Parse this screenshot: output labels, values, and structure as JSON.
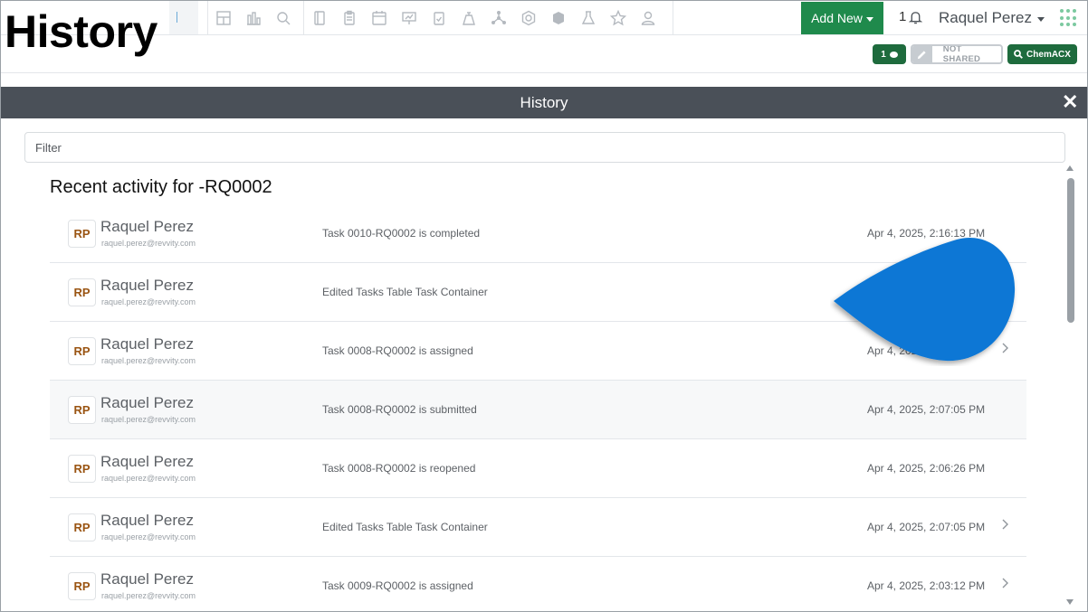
{
  "page_heading": "History",
  "topbar": {
    "add_new_label": "Add New",
    "notification_count": "1",
    "user_name": "Raquel Perez"
  },
  "subbar": {
    "comments_count": "1",
    "share_status": "NOT SHARED",
    "chemacx_label": "ChemACX"
  },
  "panel": {
    "title": "History",
    "close_label": "✕",
    "filter_placeholder": "Filter",
    "activity_title": "Recent activity for -RQ0002"
  },
  "activities": [
    {
      "initials": "RP",
      "user": "Raquel Perez",
      "email": "raquel.perez@revvity.com",
      "action": "Task 0010-RQ0002 is completed",
      "timestamp": "Apr 4, 2025, 2:16:13 PM",
      "has_details": false
    },
    {
      "initials": "RP",
      "user": "Raquel Perez",
      "email": "raquel.perez@revvity.com",
      "action": "Edited Tasks Table Task Container",
      "timestamp": "",
      "has_details": false
    },
    {
      "initials": "RP",
      "user": "Raquel Perez",
      "email": "raquel.perez@revvity.com",
      "action": "Task 0008-RQ0002 is assigned",
      "timestamp": "Apr 4, 2025",
      "has_details": true
    },
    {
      "initials": "RP",
      "user": "Raquel Perez",
      "email": "raquel.perez@revvity.com",
      "action": "Task 0008-RQ0002 is submitted",
      "timestamp": "Apr 4, 2025, 2:07:05 PM",
      "has_details": false
    },
    {
      "initials": "RP",
      "user": "Raquel Perez",
      "email": "raquel.perez@revvity.com",
      "action": "Task 0008-RQ0002 is reopened",
      "timestamp": "Apr 4, 2025, 2:06:26 PM",
      "has_details": false
    },
    {
      "initials": "RP",
      "user": "Raquel Perez",
      "email": "raquel.perez@revvity.com",
      "action": "Edited Tasks Table Task Container",
      "timestamp": "Apr 4, 2025, 2:07:05 PM",
      "has_details": true
    },
    {
      "initials": "RP",
      "user": "Raquel Perez",
      "email": "raquel.perez@revvity.com",
      "action": "Task 0009-RQ0002 is assigned",
      "timestamp": "Apr 4, 2025, 2:03:12 PM",
      "has_details": true
    }
  ],
  "colors": {
    "brand_green": "#1f8a4c",
    "panel_header": "#4a5058",
    "avatar_text": "#9a5412",
    "pointer_blue": "#0a77d5"
  }
}
